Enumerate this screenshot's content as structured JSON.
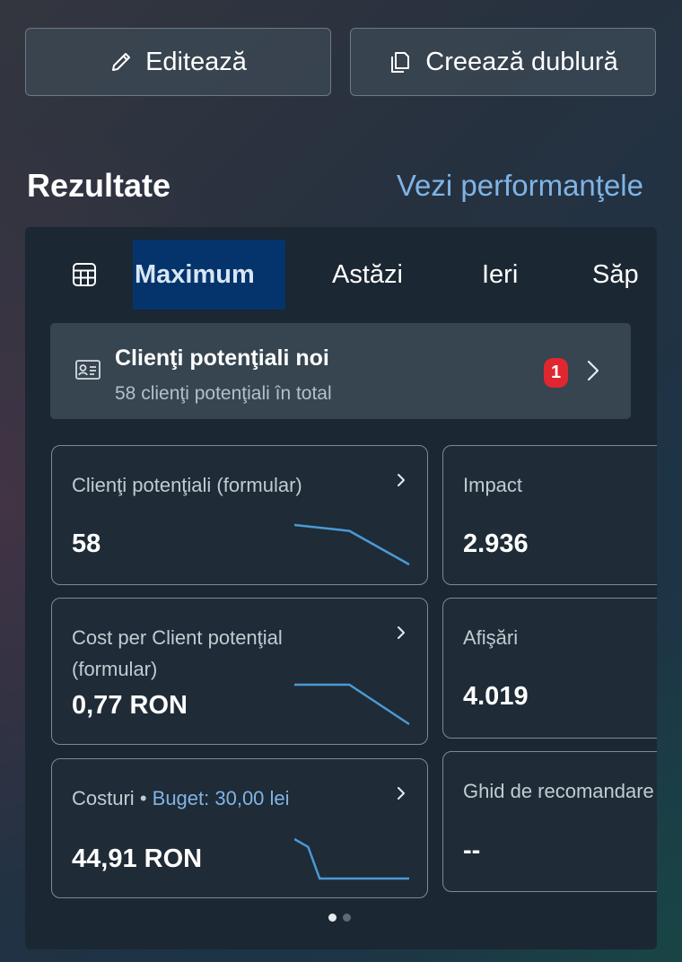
{
  "actions": {
    "edit_label": "Editează",
    "duplicate_label": "Creează dublură"
  },
  "results": {
    "title": "Rezultate",
    "performance_link": "Vezi performanţele"
  },
  "tabs": {
    "icon": "table-icon",
    "items": [
      {
        "label": "Maximum",
        "active": true
      },
      {
        "label": "Astăzi",
        "active": false
      },
      {
        "label": "Ieri",
        "active": false
      },
      {
        "label": "Săp",
        "active": false
      }
    ]
  },
  "new_leads": {
    "icon": "contact-card-icon",
    "title": "Clienţi potenţiali noi",
    "subtitle": "58 clienţi potenţiali în total",
    "badge": "1"
  },
  "metrics": [
    {
      "label": "Clienţi potenţiali (formular)",
      "value": "58",
      "sparkline": [
        1.0,
        0.85,
        0.0
      ]
    },
    {
      "label": "Impact",
      "value": "2.936"
    },
    {
      "label": "Cost per Client potenţial (formular)",
      "value": "0,77 RON",
      "sparkline": [
        1.0,
        1.0,
        0.0
      ]
    },
    {
      "label": "Afişări",
      "value": "4.019"
    },
    {
      "label": "Costuri",
      "separator": "•",
      "budget": "Buget: 30,00 lei",
      "value": "44,91 RON",
      "sparkline": [
        1.0,
        0.8,
        0.0,
        0.0
      ]
    },
    {
      "label": "Ghid de recomandare",
      "value": "--"
    }
  ],
  "pager": {
    "pages": 2,
    "current": 1
  },
  "colors": {
    "accent_link": "#7fb4e6",
    "active_tab_bg": "#04346b",
    "badge": "#e0262f",
    "sparkline": "#4a9ad6"
  }
}
